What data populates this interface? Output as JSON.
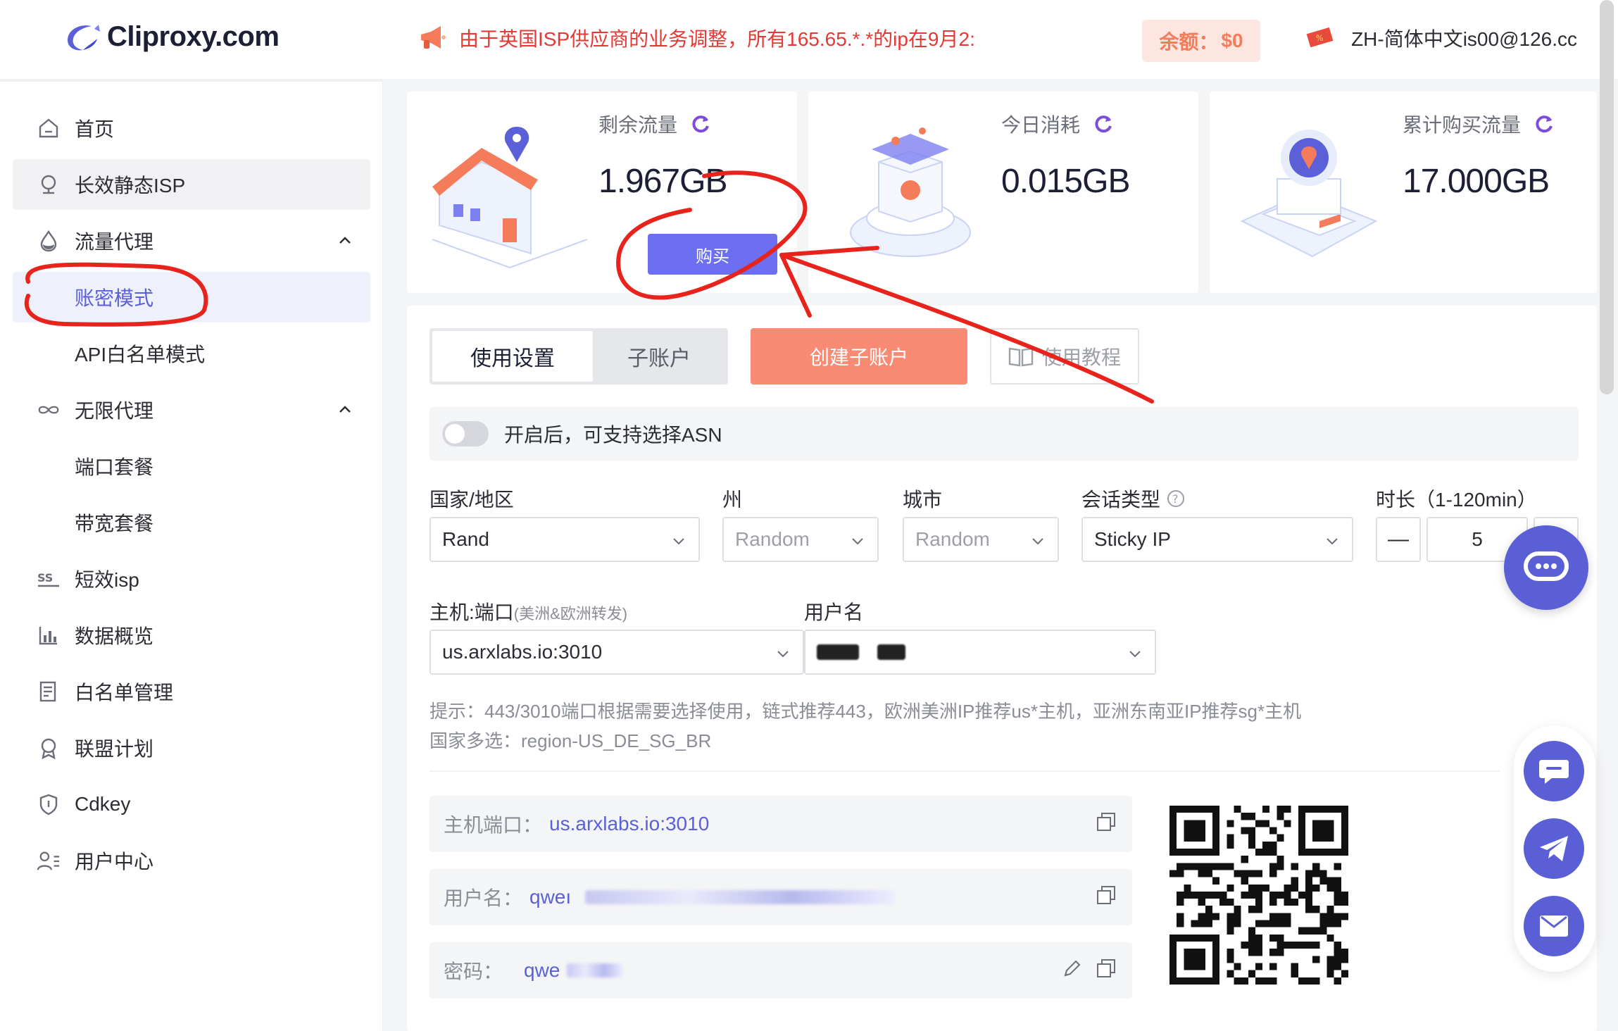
{
  "header": {
    "logo_text": "Cliproxy.com",
    "notice": "由于英国ISP供应商的业务调整，所有165.65.*.*的ip在9月2:",
    "balance_label": "余额：",
    "balance_value": "$0",
    "user_text": "ZH-简体中文is00@126.cc"
  },
  "sidebar": {
    "items": [
      {
        "label": "首页",
        "icon": "home-icon"
      },
      {
        "label": "长效静态ISP",
        "icon": "location-pin-icon"
      },
      {
        "label": "流量代理",
        "icon": "water-drop-icon"
      },
      {
        "label": "账密模式"
      },
      {
        "label": "API白名单模式"
      },
      {
        "label": "无限代理",
        "icon": "infinity-icon"
      },
      {
        "label": "端口套餐"
      },
      {
        "label": "带宽套餐"
      },
      {
        "label": "短效isp",
        "icon": "ss-icon"
      },
      {
        "label": "数据概览",
        "icon": "bar-chart-icon"
      },
      {
        "label": "白名单管理",
        "icon": "list-doc-icon"
      },
      {
        "label": "联盟计划",
        "icon": "badge-icon"
      },
      {
        "label": "Cdkey",
        "icon": "shield-icon"
      },
      {
        "label": "用户中心",
        "icon": "user-list-icon"
      }
    ]
  },
  "stats": {
    "remaining_label": "剩余流量",
    "remaining_value": "1.967GB",
    "today_label": "今日消耗",
    "today_value": "0.015GB",
    "total_label": "累计购买流量",
    "total_value": "17.000GB",
    "buy_label": "购买"
  },
  "main": {
    "tabs": [
      {
        "label": "使用设置"
      },
      {
        "label": "子账户"
      }
    ],
    "create_label": "创建子账户",
    "tutorial_label": "使用教程",
    "asn_text": "开启后，可支持选择ASN",
    "fields": {
      "country_label": "国家/地区",
      "country_value": "Rand",
      "state_label": "州",
      "state_value": "Random",
      "city_label": "城市",
      "city_value": "Random",
      "session_label": "会话类型",
      "session_value": "Sticky IP",
      "duration_label": "时长（1-120min）",
      "duration_minus": "—",
      "duration_value": "5",
      "host_label": "主机:端口",
      "host_note": "(美洲&欧洲转发)",
      "host_value": "us.arxlabs.io:3010",
      "user_label": "用户名"
    },
    "hint_line1": "提示：443/3010端口根据需要选择使用，链式推荐443，欧洲美洲IP推荐us*主机，亚洲东南亚IP推荐sg*主机",
    "hint_line2": "国家多选：region-US_DE_SG_BR",
    "info": {
      "host_label": "主机端口：",
      "host_value": "us.arxlabs.io:3010",
      "user_label": "用户名：",
      "user_value": "qweı",
      "pwd_label": "密码：",
      "pwd_value": "qwe"
    }
  },
  "colors": {
    "accent": "#5b60d8",
    "button": "#6c6ff0",
    "create": "#f98a73",
    "notice": "#e53935",
    "annotation": "#e8231b"
  }
}
